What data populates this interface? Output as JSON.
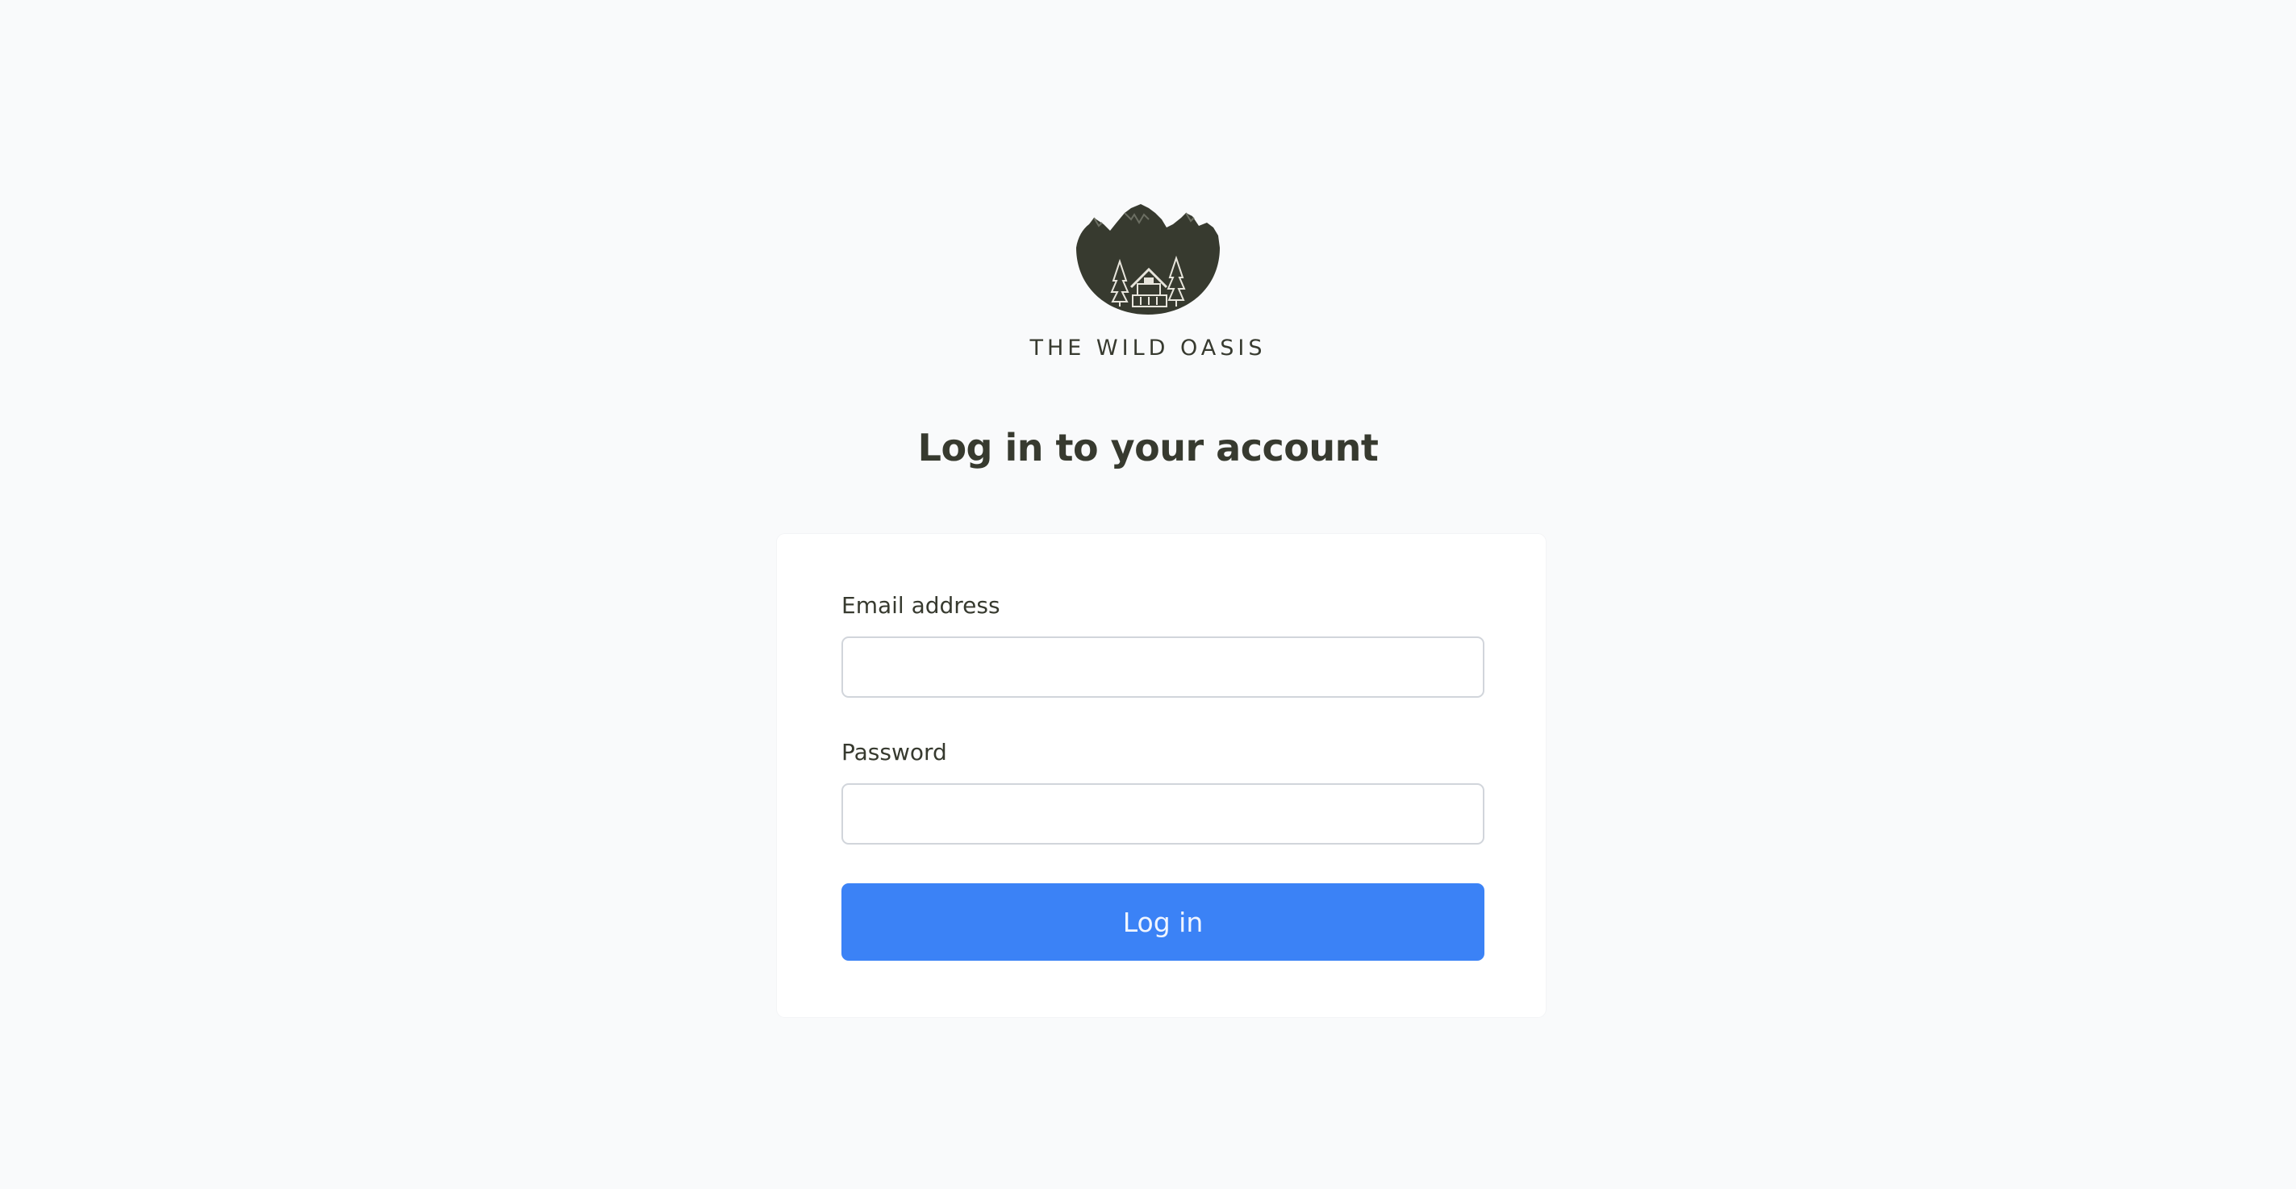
{
  "brand": {
    "name": "THE WILD OASIS",
    "logo_icon": "mountain-cabin-logo-icon",
    "color": "#373a2f"
  },
  "page": {
    "title": "Log in to your account",
    "background": "#f9fafb"
  },
  "login_form": {
    "email": {
      "label": "Email address",
      "value": "",
      "placeholder": ""
    },
    "password": {
      "label": "Password",
      "value": "",
      "placeholder": ""
    },
    "submit_label": "Log in",
    "accent_color": "#3b82f6"
  }
}
